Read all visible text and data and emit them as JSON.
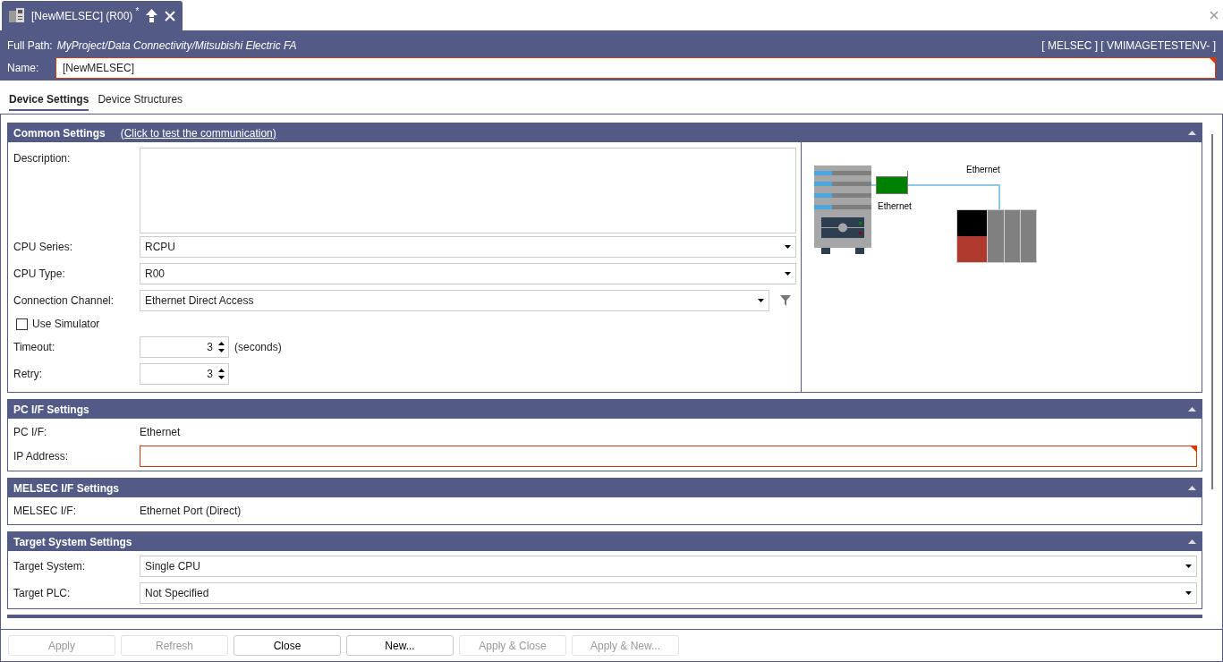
{
  "tab": {
    "title": "[NewMELSEC] (R00)",
    "modified": "*"
  },
  "header": {
    "path_label": "Full Path:",
    "path": "MyProject/Data Connectivity/Mitsubishi Electric FA",
    "context": "[ MELSEC ] [ VMIMAGETESTENV- ]",
    "name_label": "Name:",
    "name_value": "[NewMELSEC]",
    "name_invalid": true
  },
  "subtabs": [
    {
      "label": "Device Settings",
      "selected": true
    },
    {
      "label": "Device Structures",
      "selected": false
    }
  ],
  "sections": [
    {
      "title": "Common Settings",
      "link": "(Click to test the communication)",
      "expanded": true,
      "rows": [
        {
          "kind": "textarea",
          "label": "Description:"
        },
        {
          "kind": "dropdown",
          "label": "CPU Series:",
          "value": "RCPU"
        },
        {
          "kind": "dropdown",
          "label": "CPU Type:",
          "value": "R00"
        },
        {
          "kind": "dropdown",
          "label": "Connection Channel:",
          "value": "Ethernet Direct Access",
          "filter": true
        },
        {
          "kind": "checkbox",
          "label": "Use Simulator",
          "checked": false
        },
        {
          "kind": "spinner",
          "label": "Timeout:",
          "value": "3",
          "unit": "(seconds)"
        },
        {
          "kind": "spinner",
          "label": "Retry:",
          "value": "3"
        }
      ],
      "diagram": {
        "labels": [
          "Ethernet",
          "Ethernet"
        ]
      }
    },
    {
      "title": "PC I/F Settings",
      "expanded": true,
      "rows": [
        {
          "kind": "text",
          "label": "PC I/F:",
          "value": "Ethernet"
        },
        {
          "kind": "input",
          "label": "IP Address:",
          "invalid": true
        }
      ]
    },
    {
      "title": "MELSEC I/F Settings",
      "expanded": true,
      "rows": [
        {
          "kind": "text",
          "label": "MELSEC I/F:",
          "value": "Ethernet Port (Direct)"
        }
      ]
    },
    {
      "title": "Target System Settings",
      "expanded": true,
      "rows": [
        {
          "kind": "dropdown",
          "label": "Target System:",
          "value": "Single CPU"
        },
        {
          "kind": "dropdown",
          "label": "Target PLC:",
          "value": "Not Specified"
        }
      ]
    }
  ],
  "buttons": [
    {
      "label": "Apply",
      "disabled": true
    },
    {
      "label": "Refresh",
      "disabled": true
    },
    {
      "label": "Close",
      "disabled": false
    },
    {
      "label": "New...",
      "disabled": false
    },
    {
      "label": "Apply & Close",
      "disabled": true
    },
    {
      "label": "Apply & New...",
      "disabled": true
    }
  ]
}
